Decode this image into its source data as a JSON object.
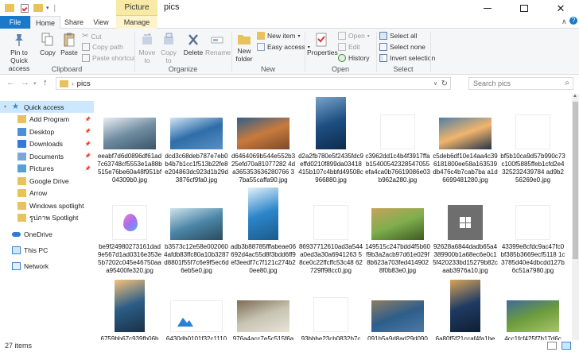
{
  "window": {
    "title": "pics",
    "context_tab": "Picture Tools"
  },
  "tabs": {
    "file": "File",
    "home": "Home",
    "share": "Share",
    "view": "View",
    "manage": "Manage"
  },
  "ribbon": {
    "clipboard": {
      "label": "Clipboard",
      "pin": "Pin to Quick access",
      "copy": "Copy",
      "paste": "Paste",
      "cut": "Cut",
      "copy_path": "Copy path",
      "paste_shortcut": "Paste shortcut"
    },
    "organize": {
      "label": "Organize",
      "move_to": "Move to",
      "copy_to": "Copy to",
      "delete": "Delete",
      "rename": "Rename"
    },
    "new": {
      "label": "New",
      "new_folder": "New folder",
      "new_item": "New item",
      "easy_access": "Easy access"
    },
    "open": {
      "label": "Open",
      "properties": "Properties",
      "open": "Open",
      "edit": "Edit",
      "history": "History"
    },
    "select": {
      "label": "Select",
      "select_all": "Select all",
      "select_none": "Select none",
      "invert": "Invert selection"
    }
  },
  "address": {
    "path": "pics",
    "search_placeholder": "Search pics"
  },
  "nav": {
    "quick_access": "Quick access",
    "items": [
      "Add Program",
      "Desktop",
      "Downloads",
      "Documents",
      "Pictures",
      "Google Drive",
      "Arrow",
      "Windows spotlight",
      "รูปภาพ Spotlight"
    ],
    "onedrive": "OneDrive",
    "this_pc": "This PC",
    "network": "Network"
  },
  "files": [
    {
      "name": "eeabf7d6d0896df61ad7c63748cf5553e1a88b515e76be60a48f951bf04309b0.jpg",
      "colors": [
        "#6f8ca0",
        "#e9eef3",
        "#3a5468"
      ]
    },
    {
      "name": "dcd3c68deb787e7eb0b4b7b1cc1f513b22fe8e204863dc923d1b29d3876cf9fa0.jpg",
      "colors": [
        "#2e6da8",
        "#cfe5f7",
        "#5a8fc2"
      ]
    },
    {
      "name": "d6464069b544e552b325efd70a81077282 4da365353636280766 37ba55caffa90.jpg",
      "colors": [
        "#c97a3c",
        "#2f5f8c",
        "#7a4a2a"
      ]
    },
    {
      "name": "d2a2fb780e5f2435fdc9effd0210f899da03418415b107c4bbfd49508c966880.jpg",
      "colors": [
        "#1d4f82",
        "#79a3c9",
        "#0e2b4d"
      ]
    },
    {
      "name": "c3962dd1c4b4f3917ffab15400542328547055efa4ca0b76619086e03b962a280.jpg",
      "colors": [
        "#fafafa",
        "#fafafa",
        "#fafafa"
      ]
    },
    {
      "name": "c5deb6df10e14aa4c396181800ee58a163539db476c4b7cab7ba a1d6699481280.jpg",
      "colors": [
        "#f1b56c",
        "#4f7fa6",
        "#22314a"
      ]
    },
    {
      "name": "bf5b10ca9d57b990c73c100f5885ffeb1cfd2e4325232439784 ad9b256269e0.jpg",
      "colors": [
        "#fafafa",
        "#fafafa",
        "#fafafa"
      ]
    },
    {
      "name": "be9f24980273161dad9e567d1ad0316e353e5b7202c045e46750aaa95400fe320.jpg",
      "colors": [
        "#fafafa",
        "#c65fe0",
        "#4cb3f0"
      ]
    },
    {
      "name": "b3573c12e58e0020604afdb83ffc80a10b3287d8801f55f7c6e9f5ec6d6eb5e0.jpg",
      "colors": [
        "#4c86a8",
        "#cfe3ec",
        "#2a4b5e"
      ]
    },
    {
      "name": "adb3b88785fffabeae06692d4ac55d8f3bdd6ff9ef3eedf7c7f121c274b20ee80.jpg",
      "colors": [
        "#2c86c9",
        "#e2f0fa",
        "#1b5a8c"
      ]
    },
    {
      "name": "86937712610ad3a544a0ed3a30a6941263 58ce0c22ffcffc53c48 62729ff98cc0.jpg",
      "colors": [
        "#fafafa",
        "#fafafa",
        "#fafafa"
      ]
    },
    {
      "name": "149515c247bdd4f5b60f9b3a2acb97d61e029f8b623a703fed4149028f0b83e0.jpg",
      "colors": [
        "#7fae4d",
        "#c6a35c",
        "#3e5b22"
      ]
    },
    {
      "name": "92628a6844dadb65a4389900b1a68ec6e0c15f420233bd15279b82caab3976a10.jpg",
      "colors": [
        "#6e6e6e",
        "#6e6e6e",
        "#6e6e6e"
      ]
    },
    {
      "name": "43399e8cfdc9ac47fc0bf385b3669ecf5118 1c3785d40e4dbcdd127b6c51a7980.jpg",
      "colors": [
        "#fafafa",
        "#fafafa",
        "#fafafa"
      ]
    },
    {
      "name": "6759bb67c939fb06b",
      "colors": [
        "#2a5d86",
        "#f4c27a",
        "#1b3048"
      ]
    },
    {
      "name": "6430db0101f32c1110",
      "colors": [
        "#ffffff",
        "#2b7fd4",
        "#ffffff"
      ]
    },
    {
      "name": "976a4acc7e5c515f6a",
      "colors": [
        "#c8c4b4",
        "#7b6d52",
        "#e8e4d6"
      ]
    },
    {
      "name": "93bbbe23cb0832b7c",
      "colors": [
        "#fafafa",
        "#fafafa",
        "#fafafa"
      ]
    },
    {
      "name": "091b5a9d8ad29d090",
      "colors": [
        "#2e5d8a",
        "#8f7d63",
        "#4c7aa6"
      ]
    },
    {
      "name": "6a80f5f21ccaf4fa1be",
      "colors": [
        "#1f3b63",
        "#d8a35a",
        "#0e1e33"
      ]
    },
    {
      "name": "4cc1fcf425f7b17d6c",
      "colors": [
        "#6d9d3c",
        "#3e6a9a",
        "#a9c56a"
      ]
    }
  ],
  "status": {
    "count_text": "27 items"
  }
}
